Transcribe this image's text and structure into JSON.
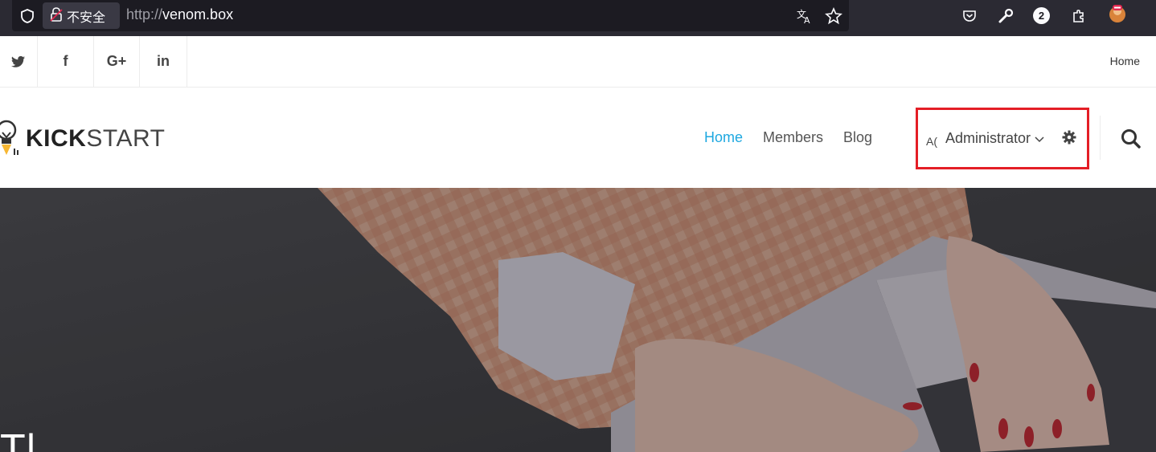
{
  "browser": {
    "security_label": "不安全",
    "url_scheme": "http://",
    "url_host": "venom.box",
    "notification_count": "2"
  },
  "topbar": {
    "social_icons": [
      "twitter-icon",
      "facebook-icon",
      "google-plus-icon",
      "linkedin-icon"
    ],
    "facebook_glyph": "f",
    "google_glyph": "G+",
    "linkedin_glyph": "in",
    "home_link": "Home"
  },
  "header": {
    "logo_bold": "KICK",
    "logo_light": "START",
    "nav": {
      "home": "Home",
      "members": "Members",
      "blog": "Blog"
    },
    "lang_glyph": "A(",
    "user_name": "Administrator",
    "accent_color": "#1ea8e0",
    "highlight_color": "#e41e26"
  },
  "hero": {
    "partial_text": "T|"
  }
}
